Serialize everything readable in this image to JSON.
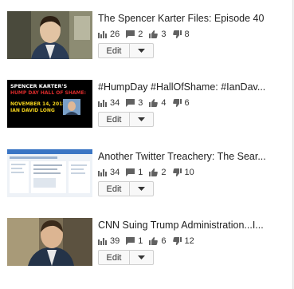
{
  "videos": [
    {
      "title": "The Spencer Karter Files: Episode 40",
      "views": "26",
      "comments": "2",
      "likes": "3",
      "dislikes": "8",
      "edit_label": "Edit"
    },
    {
      "title": "#HumpDay #HallOfShame: #IanDav...",
      "views": "34",
      "comments": "3",
      "likes": "4",
      "dislikes": "6",
      "edit_label": "Edit",
      "thumb_text": [
        "SPENCER KARTER'S",
        "HUMP DAY HALL OF SHAME:",
        "NOVEMBER 14, 2018:",
        "IAN DAVID LONG"
      ]
    },
    {
      "title": "Another Twitter Treachery: The Sear...",
      "views": "34",
      "comments": "1",
      "likes": "2",
      "dislikes": "10",
      "edit_label": "Edit"
    },
    {
      "title": "CNN Suing Trump Administration...I...",
      "views": "39",
      "comments": "1",
      "likes": "6",
      "dislikes": "12",
      "edit_label": "Edit"
    }
  ],
  "icons": {
    "views": "bar-chart-icon",
    "comments": "comment-icon",
    "likes": "thumbs-up-icon",
    "dislikes": "thumbs-down-icon",
    "menu": "caret-down-icon"
  },
  "colors": {
    "icon": "#616161",
    "thumb_promo_bg": "#000000",
    "thumb_promo_red": "#d62a2a",
    "thumb_promo_yellow": "#f2d11c"
  }
}
